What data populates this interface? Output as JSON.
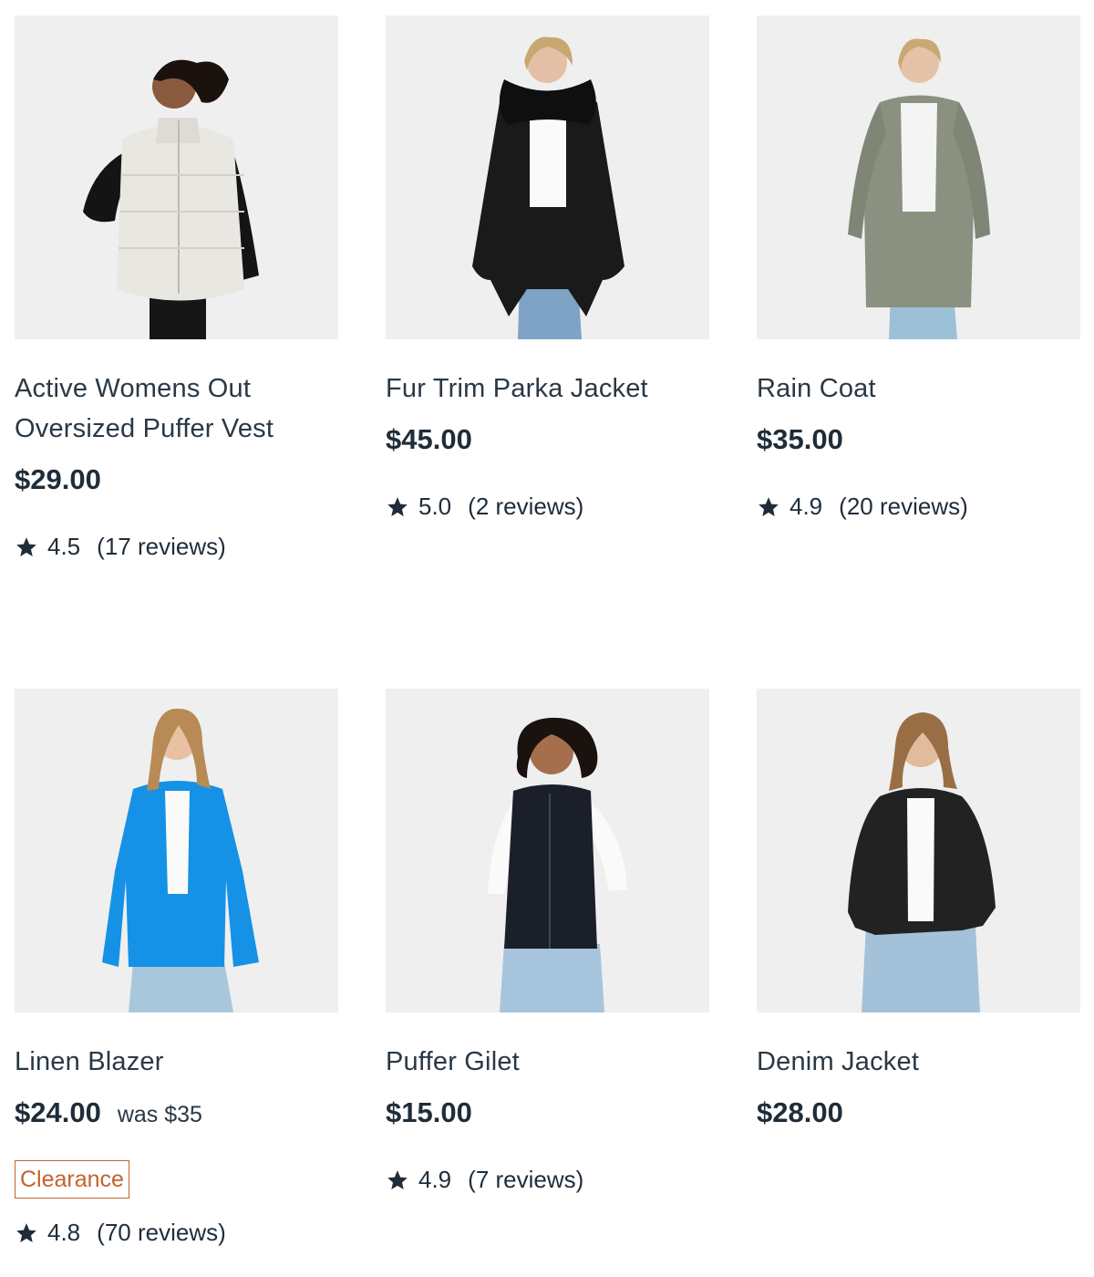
{
  "products": [
    {
      "title": "Active Womens Out Oversized Puffer Vest",
      "price": "$29.00",
      "rating": "4.5",
      "reviews": "(17 reviews)"
    },
    {
      "title": "Fur Trim Parka Jacket",
      "price": "$45.00",
      "rating": "5.0",
      "reviews": "(2 reviews)"
    },
    {
      "title": "Rain Coat",
      "price": "$35.00",
      "rating": "4.9",
      "reviews": "(20 reviews)"
    },
    {
      "title": "Linen Blazer",
      "price": "$24.00",
      "was_price": "was $35",
      "badge": "Clearance",
      "rating": "4.8",
      "reviews": "(70 reviews)"
    },
    {
      "title": "Puffer Gilet",
      "price": "$15.00",
      "rating": "4.9",
      "reviews": "(7 reviews)"
    },
    {
      "title": "Denim Jacket",
      "price": "$28.00"
    }
  ],
  "colors": {
    "image_background": "#efefef",
    "text": "#1f2d3a",
    "badge": "#c4622d",
    "vest": "#e9e7e2",
    "parka": "#1a1a1a",
    "rain_coat": "#8a9180",
    "blazer": "#1592e6",
    "gilet": "#1a1f2a",
    "denim": "#222222"
  },
  "icons": {
    "rating": "star-icon"
  }
}
